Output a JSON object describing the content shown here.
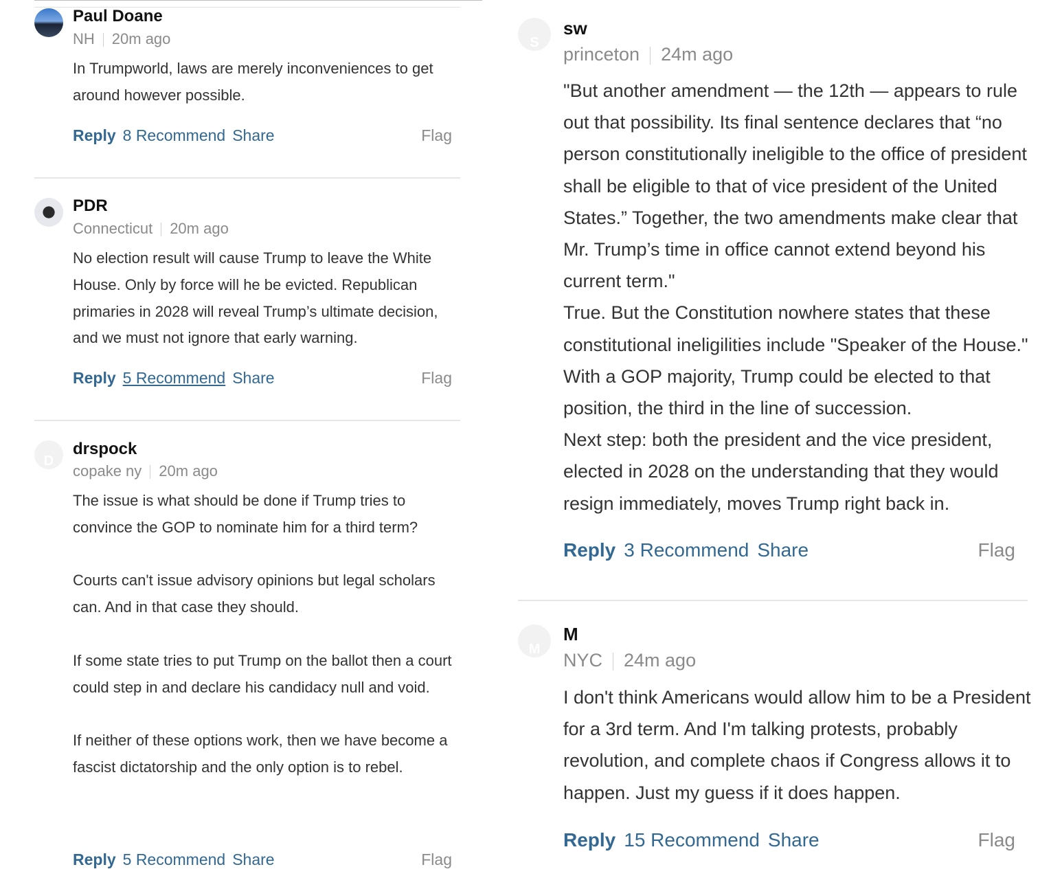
{
  "left_column": {
    "comments": [
      {
        "name": "Paul Doane",
        "location": "NH",
        "time": "20m ago",
        "avatar_initial": "",
        "paragraphs": [
          "In Trumpworld, laws are merely inconveniences to get around however possible."
        ],
        "reply_label": "Reply",
        "recommend_label": "8 Recommend",
        "share_label": "Share",
        "flag_label": "Flag"
      },
      {
        "name": "PDR",
        "location": "Connecticut",
        "time": "20m ago",
        "avatar_initial": "",
        "paragraphs": [
          "No election result will cause Trump to leave the White House. Only by force will he be evicted. Republican primaries in 2028 will reveal Trump’s ultimate decision, and we must not ignore that early warning."
        ],
        "reply_label": "Reply",
        "recommend_label": "5 Recommend",
        "share_label": "Share",
        "flag_label": "Flag"
      },
      {
        "name": "drspock",
        "location": "copake ny",
        "time": "20m ago",
        "avatar_initial": "D",
        "paragraphs": [
          "The issue is what should be done if Trump tries to convince the GOP to nominate him for a third term?",
          "Courts can't issue advisory opinions but legal scholars can. And in that case they should.",
          "If some state tries to put Trump on the ballot then a court could step in and declare his candidacy null and void.",
          "If neither of these options work, then we have become a fascist dictatorship and the only option is to rebel."
        ],
        "reply_label": "Reply",
        "recommend_label": "5 Recommend",
        "share_label": "Share",
        "flag_label": "Flag"
      }
    ]
  },
  "right_column": {
    "comments": [
      {
        "name": "sw",
        "location": "princeton",
        "time": "24m ago",
        "avatar_initial": "S",
        "paragraphs": [
          "\"But another amendment — the 12th — appears to rule out that possibility. Its final sentence declares that “no person constitutionally ineligible to the office of president shall be eligible to that of vice president of the United States.” Together, the two amendments make clear that Mr. Trump’s time in office cannot extend beyond his current term.\"",
          "True. But the Constitution nowhere states that these constitutional ineligilities include \"Speaker of the House.\" With a GOP majority, Trump could be elected to that position, the third in the line of succession.",
          "Next step:  both the president and the vice president, elected in 2028 on the understanding that they would resign immediately, moves Trump right back in."
        ],
        "reply_label": "Reply",
        "recommend_label": "3 Recommend",
        "share_label": "Share",
        "flag_label": "Flag"
      },
      {
        "name": "M",
        "location": "NYC",
        "time": "24m ago",
        "avatar_initial": "M",
        "paragraphs": [
          "I don't think Americans would allow him to be a President for a 3rd term. And I'm talking  protests, probably revolution, and complete chaos if Congress allows it to happen. Just my guess if it does happen."
        ],
        "reply_label": "Reply",
        "recommend_label": "15 Recommend",
        "share_label": "Share",
        "flag_label": "Flag"
      }
    ]
  },
  "colors": {
    "link": "#326891",
    "name": "#121212",
    "meta": "#8a8a8a",
    "body": "#333333",
    "divider": "#e6e6e6"
  }
}
